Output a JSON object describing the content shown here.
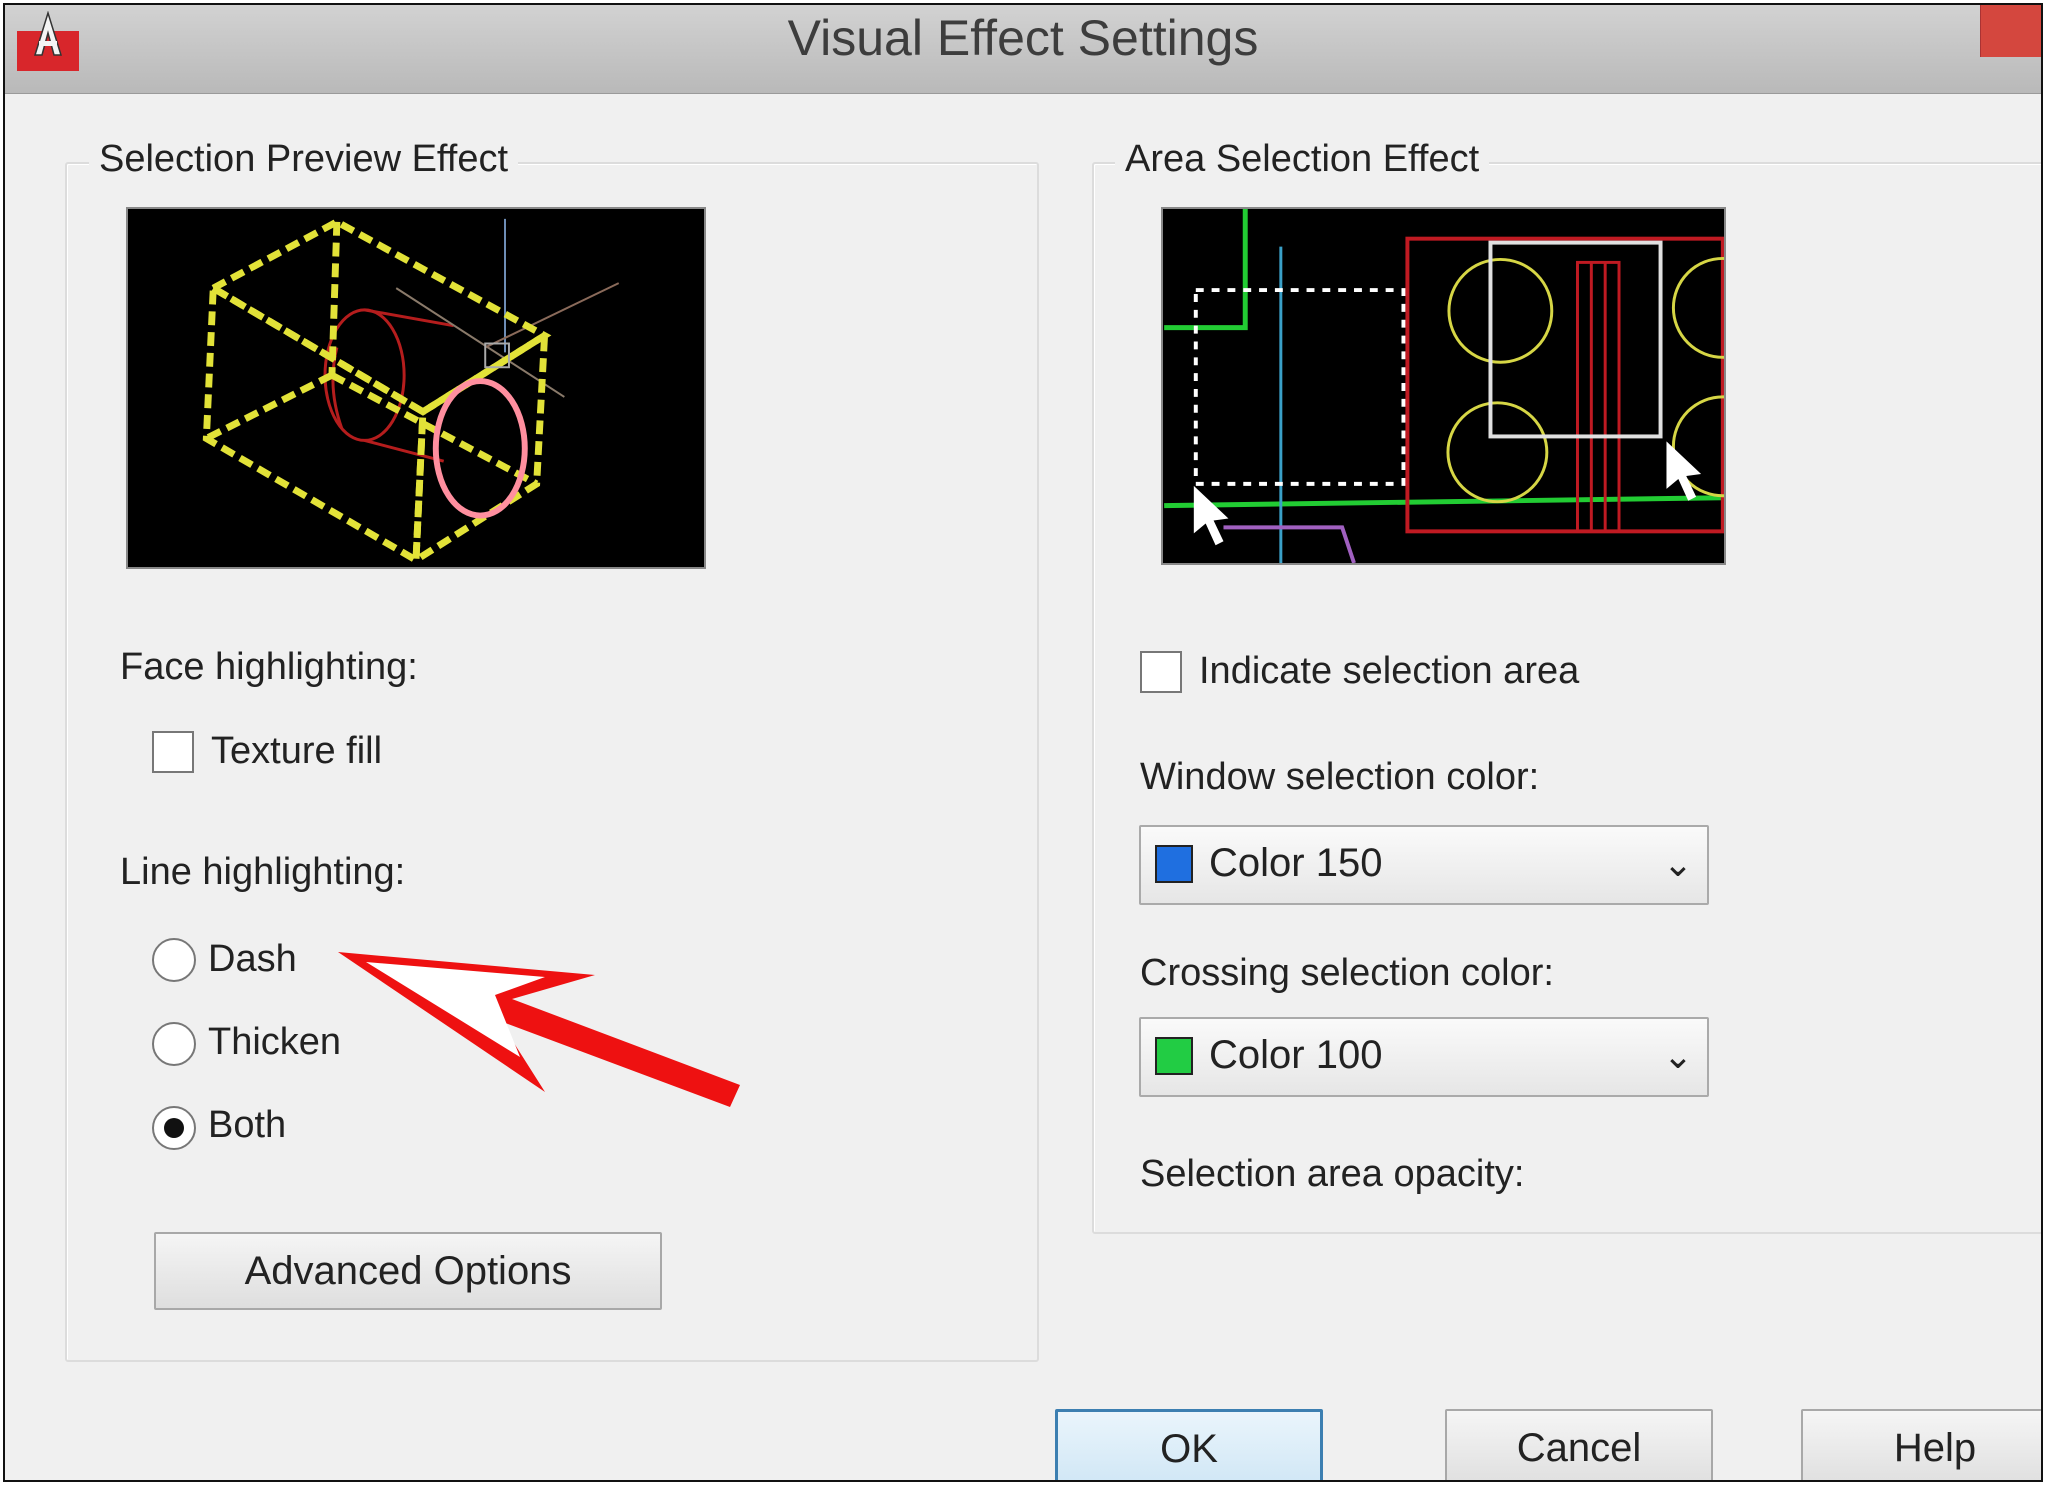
{
  "window": {
    "title": "Visual Effect Settings",
    "app_icon": "autocad-icon",
    "close_icon": "close-icon"
  },
  "selection_preview": {
    "group_label": "Selection Preview Effect",
    "face_highlighting_label": "Face highlighting:",
    "texture_fill_label": "Texture fill",
    "texture_fill_checked": false,
    "line_highlighting_label": "Line highlighting:",
    "line_options": [
      {
        "label": "Dash",
        "selected": false
      },
      {
        "label": "Thicken",
        "selected": false
      },
      {
        "label": "Both",
        "selected": true
      }
    ],
    "advanced_options_label": "Advanced Options"
  },
  "area_selection": {
    "group_label": "Area Selection Effect",
    "indicate_area_label": "Indicate selection area",
    "indicate_area_checked": false,
    "window_color_label": "Window selection color:",
    "window_color_value": "Color 150",
    "window_color_swatch": "#1f6fe0",
    "crossing_color_label": "Crossing selection color:",
    "crossing_color_value": "Color 100",
    "crossing_color_swatch": "#22cc44",
    "opacity_label": "Selection area opacity:"
  },
  "footer": {
    "ok_label": "OK",
    "cancel_label": "Cancel",
    "help_label": "Help"
  },
  "annotation": {
    "arrow_color": "#ee1111",
    "arrow_icon": "red-arrow-icon"
  }
}
